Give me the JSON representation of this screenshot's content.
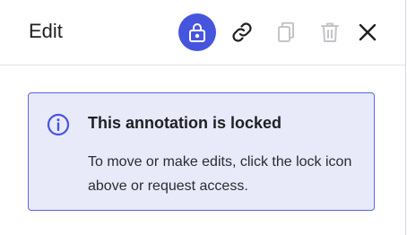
{
  "header": {
    "title": "Edit"
  },
  "toolbar": {
    "buttons": [
      {
        "icon": "lock-icon",
        "state": "active"
      },
      {
        "icon": "link-icon",
        "state": "enabled"
      },
      {
        "icon": "duplicate-icon",
        "state": "disabled"
      },
      {
        "icon": "trash-icon",
        "state": "disabled"
      },
      {
        "icon": "close-icon",
        "state": "enabled"
      }
    ]
  },
  "notice": {
    "icon": "info-icon",
    "title": "This annotation is locked",
    "body": "To move or make edits, click the lock icon above or request access."
  },
  "colors": {
    "accent": "#4655dd",
    "notice_background": "#e8eafa",
    "notice_border": "#5b66d8",
    "disabled_icon": "#c4c4c9"
  }
}
